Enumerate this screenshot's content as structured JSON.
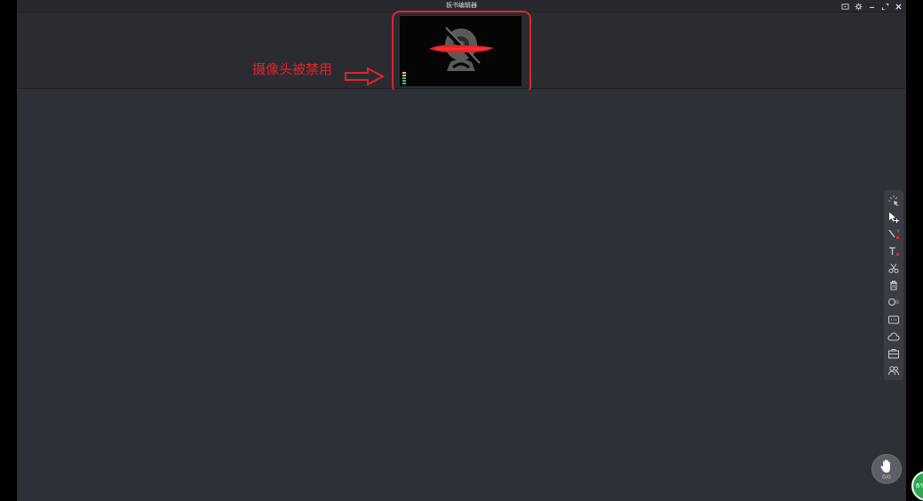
{
  "window": {
    "title": "板书编辑器",
    "controls": [
      {
        "name": "screen-share-icon"
      },
      {
        "name": "gear-icon"
      },
      {
        "name": "minimize-icon"
      },
      {
        "name": "restore-icon"
      },
      {
        "name": "close-icon"
      }
    ]
  },
  "video": {
    "state": "camera-disabled",
    "annotation": "摄像头被禁用",
    "audio_level_colors": [
      "#f2c94c",
      "#f2c94c",
      "#2ecc71",
      "#2ecc71",
      "#2ecc71"
    ]
  },
  "toolbar": {
    "tools": [
      {
        "name": "laser-pointer-icon"
      },
      {
        "name": "select-move-icon"
      },
      {
        "name": "pen-icon",
        "indicator": "#e2232a"
      },
      {
        "name": "text-icon",
        "indicator": "#e2232a"
      },
      {
        "name": "scissors-icon"
      },
      {
        "name": "trash-icon"
      },
      {
        "name": "shape-icon"
      },
      {
        "name": "subtitle-icon"
      },
      {
        "name": "cloud-icon"
      },
      {
        "name": "toolbox-icon"
      },
      {
        "name": "users-icon"
      }
    ]
  },
  "raise_hand": {
    "count": "0/0"
  },
  "colors": {
    "accent_red": "#e2232a",
    "background": "#2e3038",
    "badge_green": "#2fa84f"
  }
}
